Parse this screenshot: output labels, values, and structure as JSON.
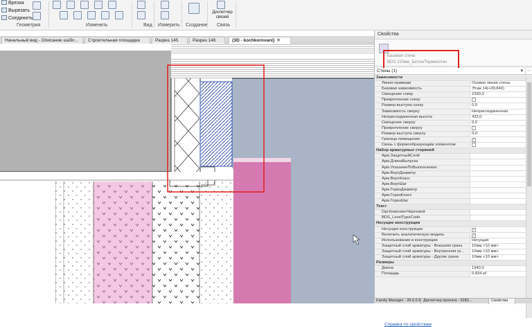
{
  "ribbon": {
    "items": {
      "cut_into": "Врезка",
      "cut": "Вырезать",
      "join": "Соединить"
    },
    "groups": {
      "geometry": "Геометрия",
      "modify": "Изменить",
      "view": "Вид",
      "measure": "Измерить",
      "create": "Создание",
      "link": "Связь"
    },
    "link_manager": "Диспетчер связей"
  },
  "tabs": [
    {
      "label": "Начальный вид - Описание шабл..."
    },
    {
      "label": "Строительная площадка"
    },
    {
      "label": "Разрез 145"
    },
    {
      "label": "Разрез 146"
    },
    {
      "label": "{3D - kochkorovani}",
      "active": true
    }
  ],
  "properties": {
    "title": "Свойства",
    "type_family": "Базовая стена",
    "type_name": "BDS 220мм_Бетон/Термокотел",
    "filter": "Стены (1)",
    "edit_type": "...",
    "groups": [
      {
        "name": "Зависимости",
        "rows": [
          {
            "name": "Линия привязки",
            "value": "Осевая линия стены"
          },
          {
            "name": "Базовая зависимость",
            "value": "Этаж 14(+39,840)"
          },
          {
            "name": "Смещение снизу",
            "value": "2390,0"
          },
          {
            "name": "Прикрепление снизу",
            "check": false
          },
          {
            "name": "Размер выступа снизу",
            "value": "0,0"
          },
          {
            "name": "Зависимость сверху",
            "value": "Неприсоединенная"
          },
          {
            "name": "Неприсоединенная высота",
            "value": "432,0"
          },
          {
            "name": "Смещение сверху",
            "value": "0,0"
          },
          {
            "name": "Прикрепление сверху",
            "check": false
          },
          {
            "name": "Размер выступа сверху",
            "value": "0,0"
          },
          {
            "name": "Граница помещения",
            "check": true
          },
          {
            "name": "Связь с формообразующим элементом",
            "check": false
          }
        ]
      },
      {
        "name": "Набор арматурных стержней",
        "rows": [
          {
            "name": "Арм.ЗащитныйСлой",
            "value": ""
          },
          {
            "name": "Арм.ДлинаВыпуска",
            "value": ""
          },
          {
            "name": "Арм.УказаниеПоВыполнению",
            "value": ""
          },
          {
            "name": "Арм.ВертДиаметр",
            "value": ""
          },
          {
            "name": "Арм.ВертКласс",
            "value": ""
          },
          {
            "name": "Арм.ВертШаг",
            "value": ""
          },
          {
            "name": "Арм.ГоризДиаметр",
            "value": ""
          },
          {
            "name": "Арм.ГоризКласс",
            "value": ""
          },
          {
            "name": "Арм.ГоризШаг",
            "value": ""
          }
        ]
      },
      {
        "name": "Текст",
        "rows": [
          {
            "name": "Орг.КомплектЧертежей",
            "value": ""
          },
          {
            "name": "BDS_LevelTypeCode",
            "value": ""
          }
        ]
      },
      {
        "name": "Несущие конструкции",
        "rows": [
          {
            "name": "Несущие конструкции",
            "check": true
          },
          {
            "name": "Включить аналитическую модель",
            "check": true
          },
          {
            "name": "Использование в конструкции",
            "value": "Несущая"
          },
          {
            "name": "Защитный слой арматуры - Внешняя грань",
            "value": "10мм <10 мм>"
          },
          {
            "name": "Защитный слой арматуры - Внутренняя гр...",
            "value": "10мм <10 мм>"
          },
          {
            "name": "Защитный слой арматуры - Другие грани",
            "value": "10мм <10 мм>"
          }
        ]
      },
      {
        "name": "Размеры",
        "rows": [
          {
            "name": "Длина",
            "value": "1940,0"
          },
          {
            "name": "Площадь",
            "value": "0,834 м²"
          }
        ]
      }
    ],
    "help_link": "Справка по свойствам"
  },
  "bottom_tabs": [
    {
      "label": "Family Manager - 26.6.0.9"
    },
    {
      "label": "Диспетчер проекта - 0283..."
    },
    {
      "label": "Свойства",
      "active": true
    }
  ],
  "colors": {
    "highlight": "#e02020",
    "pink_fill": "#f2c8e3",
    "magenta_fill": "#d47ab0",
    "bluegrey_fill": "#a9b4c6",
    "grey_fill": "#b2b2b2"
  }
}
